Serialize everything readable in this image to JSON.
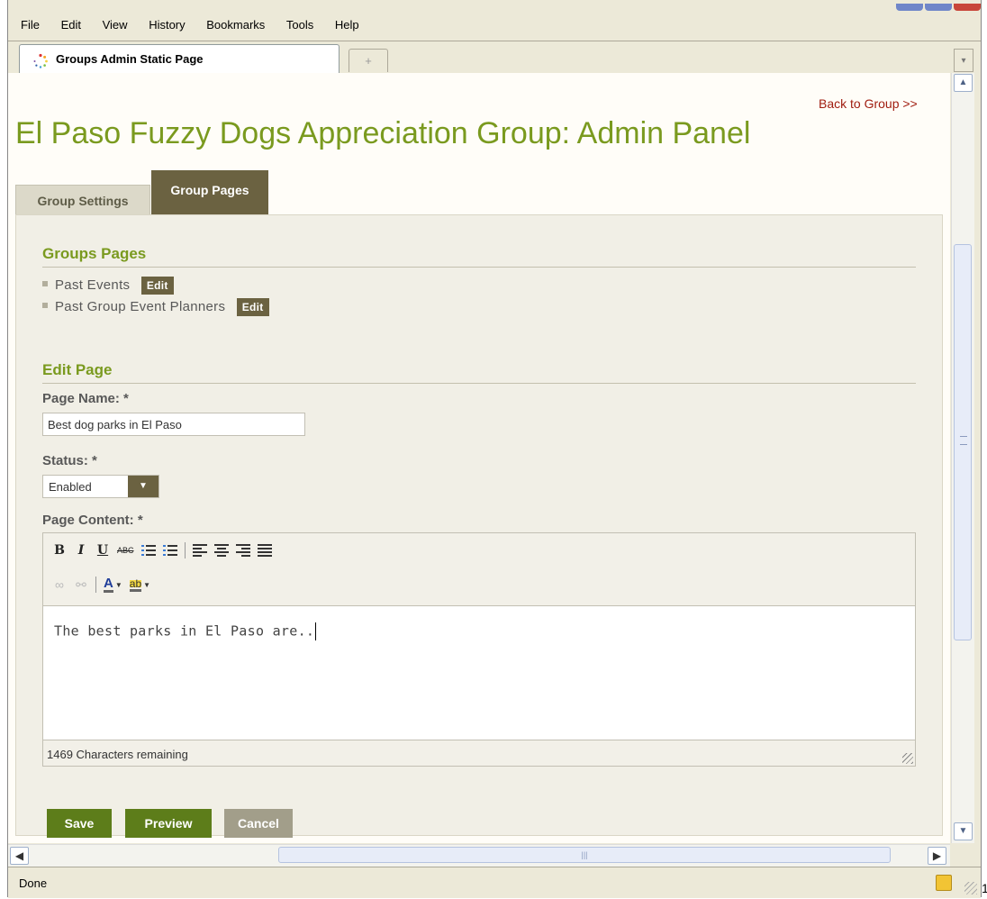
{
  "menu": [
    "File",
    "Edit",
    "View",
    "History",
    "Bookmarks",
    "Tools",
    "Help"
  ],
  "tab": {
    "title": "Groups Admin Static Page",
    "new_tab": "+"
  },
  "page": {
    "back_link": "Back to Group >>",
    "title": "El Paso Fuzzy Dogs Appreciation Group: Admin Panel",
    "tabs": [
      {
        "label": "Group Settings",
        "active": false
      },
      {
        "label": "Group Pages",
        "active": true
      }
    ]
  },
  "groups_pages": {
    "heading": "Groups Pages",
    "items": [
      {
        "label": "Past Events",
        "action": "Edit"
      },
      {
        "label": "Past Group Event Planners",
        "action": "Edit"
      }
    ]
  },
  "edit_page": {
    "heading": "Edit Page",
    "page_name": {
      "label": "Page Name: *",
      "value": "Best dog parks in El Paso"
    },
    "status": {
      "label": "Status: *",
      "value": "Enabled"
    },
    "content": {
      "label": "Page Content: *",
      "text": "The best parks in El Paso are..",
      "chars_remaining": "1469 Characters remaining",
      "toolbar_row1": [
        "B",
        "I",
        "U",
        "ABC"
      ],
      "toolbar_row2_icons": [
        "link-icon",
        "unlink-icon",
        "font-color-icon",
        "highlight-color-icon"
      ]
    }
  },
  "buttons": {
    "save": "Save",
    "preview": "Preview",
    "cancel": "Cancel"
  },
  "status_bar": {
    "text": "Done"
  },
  "margin_text": "1",
  "colors": {
    "accent_green": "#7a9a1f",
    "brown": "#6b6241",
    "link_red": "#a01d10",
    "button_green": "#5d7d1a",
    "button_grey": "#a29e8a"
  }
}
